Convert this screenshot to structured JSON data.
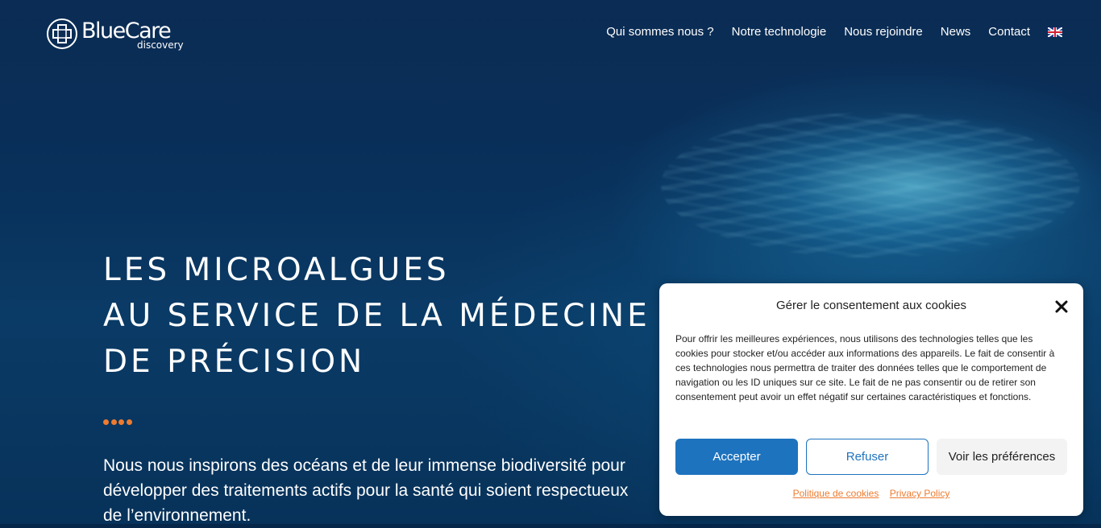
{
  "logo": {
    "name": "BlueCare",
    "sub": "discovery"
  },
  "nav": {
    "items": [
      "Qui sommes nous ?",
      "Notre technologie",
      "Nous rejoindre",
      "News",
      "Contact"
    ],
    "language_flag": "uk-flag-icon"
  },
  "hero": {
    "title_lines": [
      "LES MICROALGUES",
      "AU SERVICE DE LA MÉDECINE",
      "DE PRÉCISION"
    ],
    "text": "Nous nous inspirons des océans et de leur immense biodiversité pour développer des traitements actifs pour la santé qui soient respectueux de l’environnement."
  },
  "cookie": {
    "title": "Gérer le consentement aux cookies",
    "body": "Pour offrir les meilleures expériences, nous utilisons des technologies telles que les cookies pour stocker et/ou accéder aux informations des appareils. Le fait de consentir à ces technologies nous permettra de traiter des données telles que le comportement de navigation ou les ID uniques sur ce site. Le fait de ne pas consentir ou de retirer son consentement peut avoir un effet négatif sur certaines caractéristiques et fonctions.",
    "accept_label": "Accepter",
    "refuse_label": "Refuser",
    "prefs_label": "Voir les préférences",
    "links": [
      "Politique de cookies",
      "Privacy Policy"
    ]
  },
  "colors": {
    "accent": "#1e73be",
    "orange": "#ee7b30",
    "background": "#06264a"
  }
}
